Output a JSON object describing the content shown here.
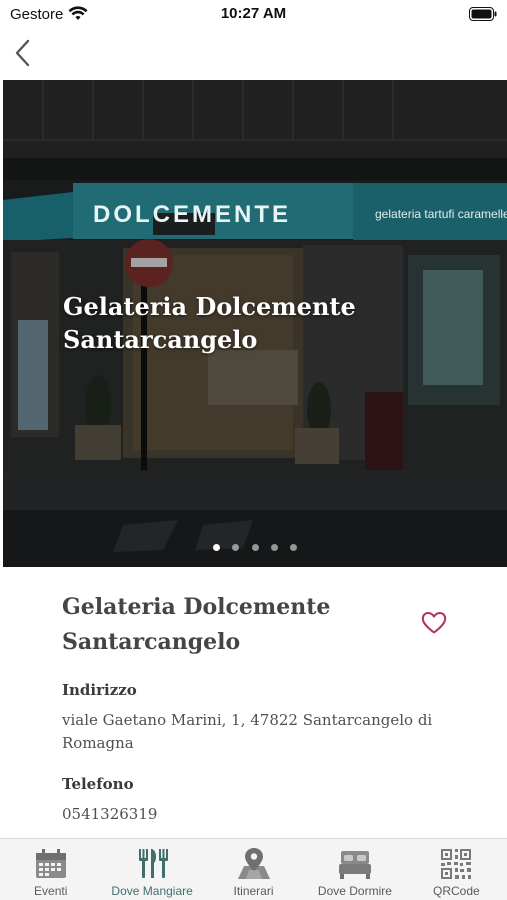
{
  "status_bar": {
    "carrier": "Gestore",
    "time": "10:27 AM"
  },
  "hero": {
    "title": "Gelateria Dolcemente Santarcangelo",
    "sign_text": "DOLCEMENTE",
    "side_sign_text": "gelateria  tartufi  caramelle",
    "slide_count": 5,
    "active_slide": 1
  },
  "details": {
    "name": "Gelateria Dolcemente Santarcangelo",
    "address_label": "Indirizzo",
    "address": "viale Gaetano Marini, 1, 47822 Santarcangelo di Romagna",
    "phone_label": "Telefono",
    "phone": "0541326319"
  },
  "tabs": [
    {
      "label": "Eventi",
      "icon": "calendar-icon",
      "active": false
    },
    {
      "label": "Dove Mangiare",
      "icon": "fork-knife-icon",
      "active": true
    },
    {
      "label": "Itinerari",
      "icon": "map-pin-icon",
      "active": false
    },
    {
      "label": "Dove Dormire",
      "icon": "bed-icon",
      "active": false
    },
    {
      "label": "QRCode",
      "icon": "qrcode-icon",
      "active": false
    }
  ],
  "colors": {
    "accent": "#3f6e6c",
    "heart": "#b5325a",
    "icon_gray": "#8a8a8a"
  }
}
